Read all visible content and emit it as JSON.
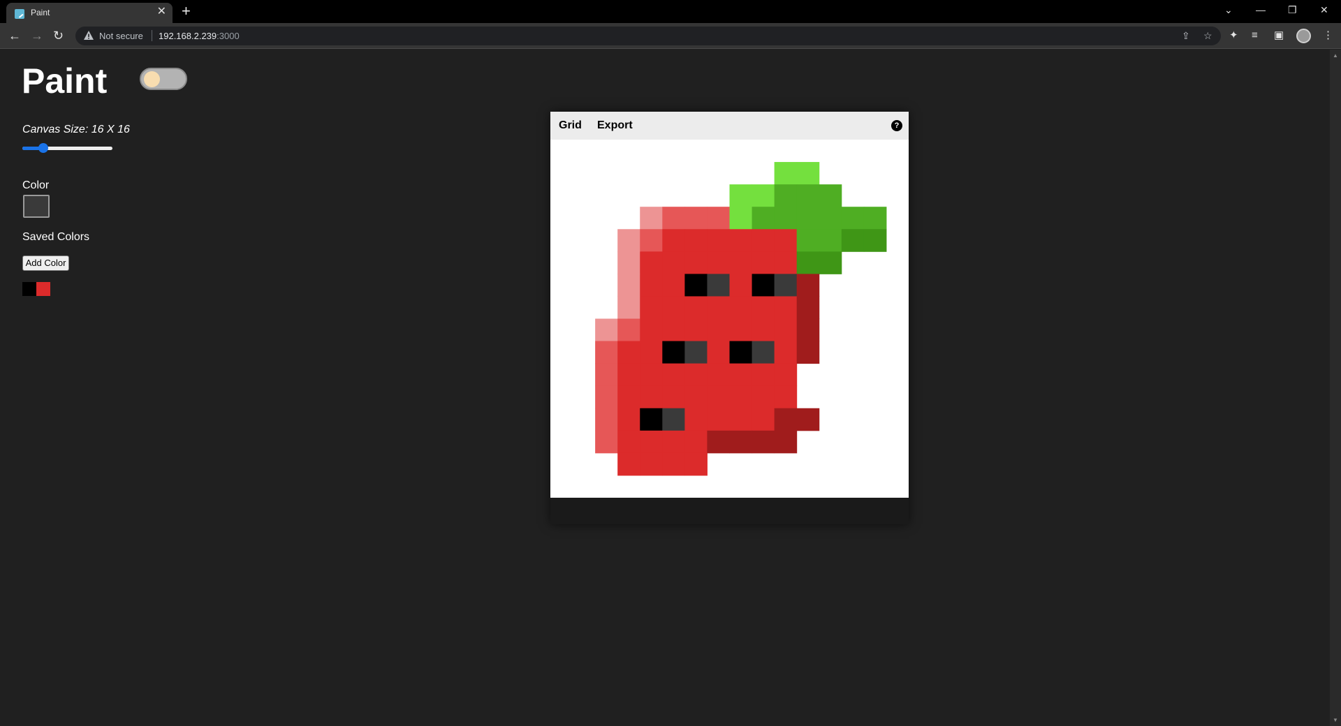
{
  "browser": {
    "tab_title": "Paint",
    "tab_close": "✕",
    "new_tab": "+",
    "security_label": "Not secure",
    "url_host": "192.168.2.239",
    "url_port": ":3000"
  },
  "app": {
    "title": "Paint",
    "canvas_size_label": "Canvas Size: 16 X 16",
    "canvas_size": 16,
    "color_label": "Color",
    "current_color": "#3a3a3a",
    "saved_colors_label": "Saved Colors",
    "add_color_label": "Add Color",
    "saved_colors": [
      "#000000",
      "#dc2b2b"
    ],
    "theme_toggle_on": false
  },
  "editor": {
    "menu": [
      "Grid",
      "Export"
    ],
    "help_label": "?",
    "palette": {
      "R": "#dc2b2b",
      "M": "#e65757",
      "L": "#ed9494",
      "D": "#a01c1c",
      "G": "#74e03e",
      "g": "#4fae23",
      "h": "#3f9616",
      "K": "#000000",
      "k": "#3a3a3a"
    },
    "pixels": [
      "................",
      "..........GG....",
      "........GGggg...",
      "....LMMMGgggggg.",
      "...LMRRRRRRgghh.",
      "...LRRRRRRRhh...",
      "...LRRKkRKkD....",
      "...LRRRRRRRD....",
      "..LMRRRRRRRD....",
      "..MRRKkRKkRD....",
      "..MRRRRRRRR.....",
      "..MRRRRRRRR.....",
      "..MRKkRRRRDD....",
      "..MRRRRDDDD.....",
      "...RRRR.........",
      "................"
    ]
  }
}
